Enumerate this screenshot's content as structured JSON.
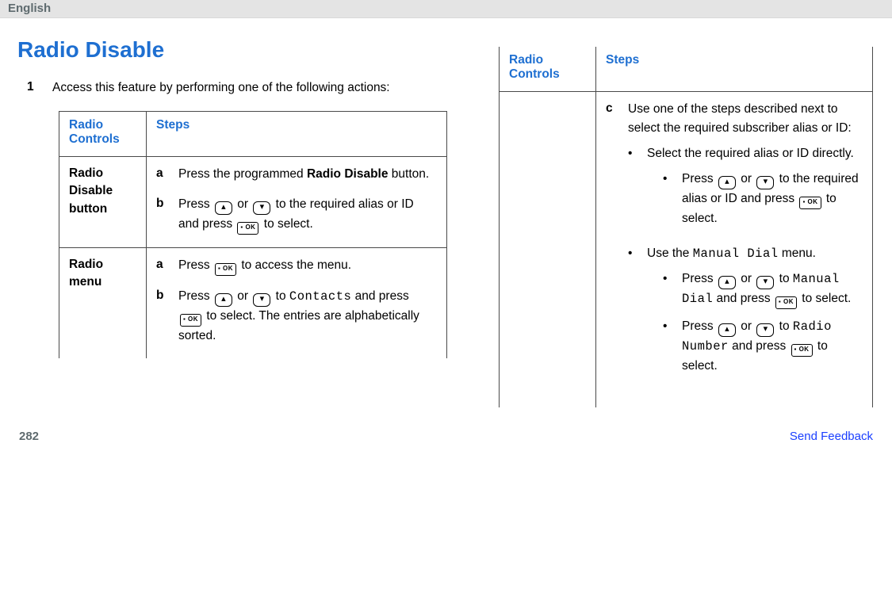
{
  "header": {
    "language": "English"
  },
  "title": "Radio Disable",
  "step1": {
    "marker": "1",
    "text": "Access this feature by performing one of the following actions:"
  },
  "table_left": {
    "headers": {
      "col1": "Radio Controls",
      "col2": "Steps"
    },
    "row1": {
      "label": "Radio Disable button",
      "a_marker": "a",
      "a_pre": "Press the programmed ",
      "a_bold": "Radio Disable",
      "a_post": " button.",
      "b_marker": "b",
      "b1": "Press ",
      "b2": " or ",
      "b3": " to the required alias or ID and press ",
      "b4": " to select."
    },
    "row2": {
      "label": "Radio menu",
      "a_marker": "a",
      "a1": "Press ",
      "a2": " to access the menu.",
      "b_marker": "b",
      "b1": "Press ",
      "b2": " or ",
      "b3": " to ",
      "b_mono": "Contacts",
      "b4": " and press ",
      "b5": " to select. The entries are alphabetically sorted."
    }
  },
  "table_right": {
    "headers": {
      "col1": "Radio Controls",
      "col2": "Steps"
    },
    "c_marker": "c",
    "c_intro": "Use one of the steps described next to select the required subscriber alias or ID:",
    "bul1": "Select the required alias or ID directly.",
    "bul1a_1": "Press ",
    "bul1a_2": " or ",
    "bul1a_3": " to the required alias or ID and press ",
    "bul1a_4": " to select.",
    "bul2_1": "Use the ",
    "bul2_mono": "Manual Dial",
    "bul2_2": " menu.",
    "bul2a_1": "Press ",
    "bul2a_2": " or ",
    "bul2a_3": " to ",
    "bul2a_mono": "Manual Dial",
    "bul2a_4": " and press ",
    "bul2a_5": " to select.",
    "bul2b_1": "Press ",
    "bul2b_2": " or ",
    "bul2b_3": " to ",
    "bul2b_mono": "Radio Number",
    "bul2b_4": " and press ",
    "bul2b_5": " to select."
  },
  "icons": {
    "up": "▴",
    "down": "▾",
    "ok": "▪ OK"
  },
  "footer": {
    "page": "282",
    "feedback": "Send Feedback"
  }
}
